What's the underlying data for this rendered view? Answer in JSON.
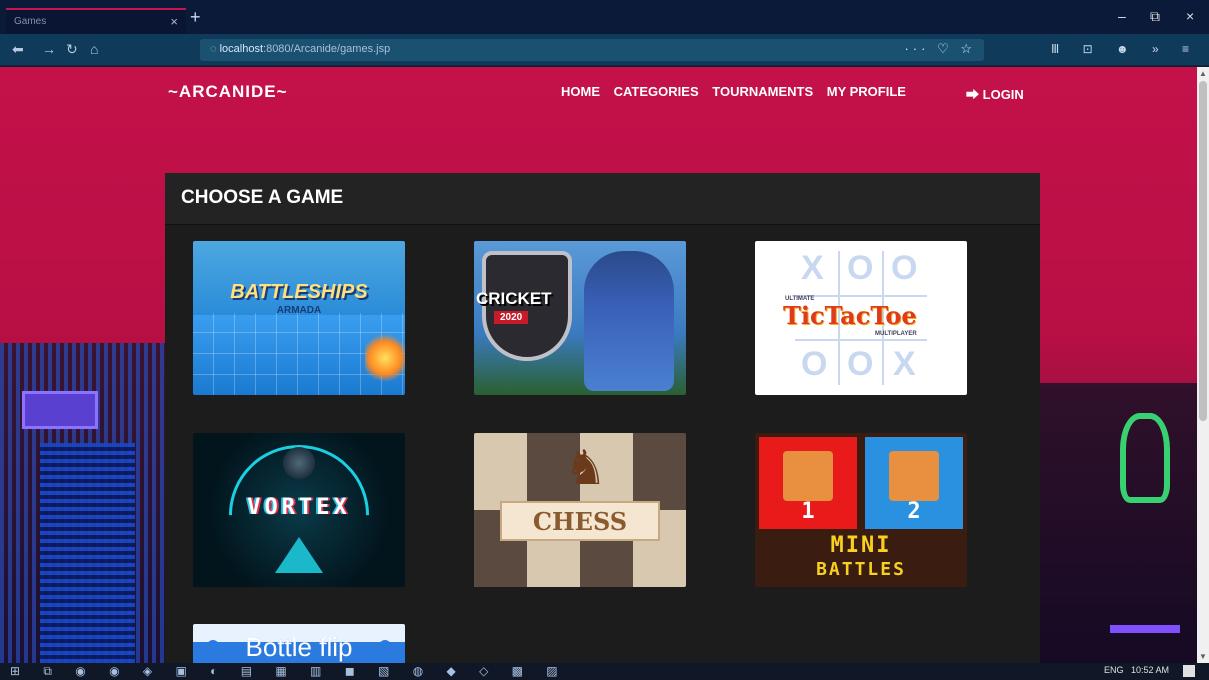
{
  "browser": {
    "tab_title": "Games",
    "tab_close": "×",
    "new_tab": "+",
    "url_host": "localhost",
    "url_path": ":8080/Arcanide/games.jsp",
    "url_actions": "··· ♡ ☆",
    "toolbar_icons": "Ⅲ ⊡ ☻ » ≡",
    "window_controls": [
      "–",
      "⧉",
      "×"
    ]
  },
  "site": {
    "logo": "~ARCANIDE~",
    "nav": [
      "HOME",
      "CATEGORIES",
      "TOURNAMENTS",
      "MY PROFILE"
    ],
    "login": "LOGIN",
    "login_icon": "⮕"
  },
  "panel": {
    "title": "CHOOSE A GAME"
  },
  "games": {
    "battleships": {
      "title": "BATTLESHIPS",
      "sub": "ARMADA"
    },
    "cricket": {
      "title": "CRICKET",
      "year": "2020"
    },
    "tictactoe": {
      "title": "TicTacToe",
      "top": "ULTIMATE",
      "bottom": "MULTIPLAYER",
      "x": "X",
      "o": "O"
    },
    "vortex": {
      "title": "VORTEX"
    },
    "chess": {
      "title": "CHESS",
      "knight": "♞"
    },
    "minibattles": {
      "p1": "1",
      "p2": "2",
      "line1": "MINI",
      "line2": "BATTLES"
    },
    "bottleflip": {
      "title": "Bottle flip"
    }
  },
  "taskbar": {
    "tray_lang": "ENG",
    "time": "10:52 AM"
  },
  "colors": {
    "page_bg": "#c4114a",
    "panel_bg": "#1c1c1c",
    "chrome_bg": "#0c1a3a",
    "navbar_bg": "#0f3a5a"
  }
}
